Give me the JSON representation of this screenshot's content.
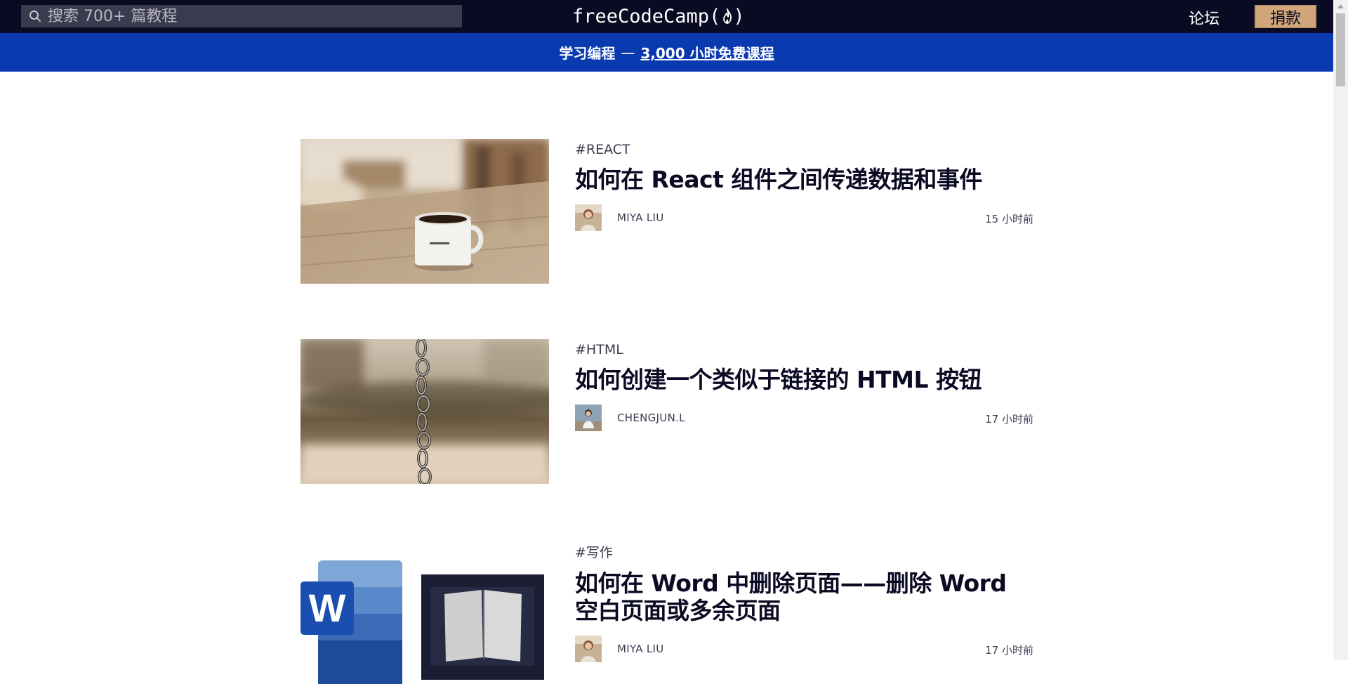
{
  "header": {
    "search": {
      "placeholder": "搜索 700+ 篇教程",
      "value": ""
    },
    "brand": "freeCodeCamp(",
    "brand_close": ")",
    "forum": "论坛",
    "donate": "捐款"
  },
  "banner": {
    "text": "学习编程",
    "dash": "—",
    "link": "3,000 小时免费课程"
  },
  "articles": [
    {
      "tag": "#REACT",
      "title": "如何在 React 组件之间传递数据和事件",
      "author": "MIYA LIU",
      "time": "15 小时前"
    },
    {
      "tag": "#HTML",
      "title": "如何创建一个类似于链接的 HTML 按钮",
      "author": "CHENGJUN.L",
      "time": "17 小时前"
    },
    {
      "tag": "#写作",
      "title": "如何在 Word 中删除页面——删除 Word 空白页面或多余页面",
      "author": "MIYA LIU",
      "time": "17 小时前"
    }
  ],
  "colors": {
    "nav_bg": "#0a0a23",
    "banner_bg": "#0a3ab0",
    "donate_bg": "#d0a67a",
    "text_dark": "#0a0a23",
    "text_meta": "#3b3b4f"
  },
  "icons": {
    "search": "search-icon",
    "brand": "fire-icon",
    "scroll": "scroll-up-arrow-icon"
  }
}
